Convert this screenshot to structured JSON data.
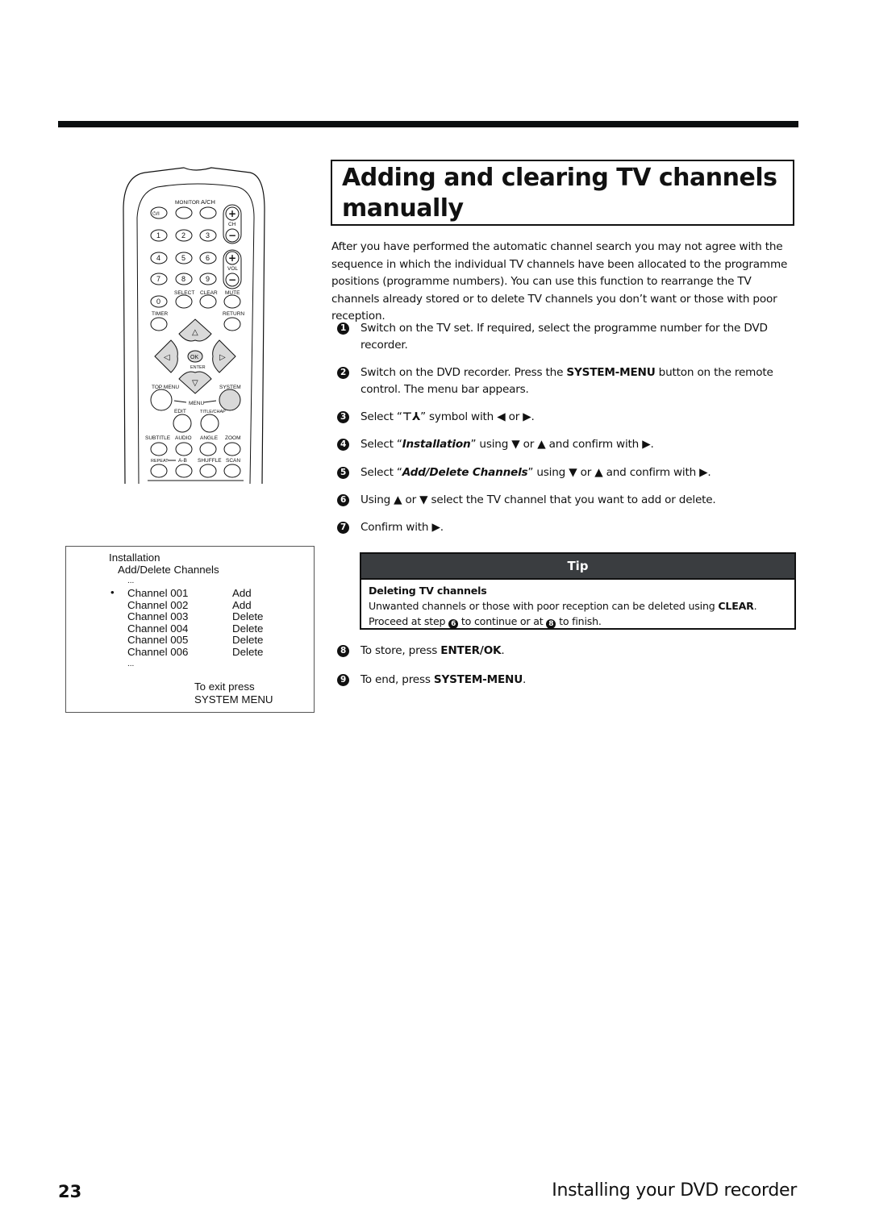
{
  "page": {
    "title_line1": "Adding and clearing TV channels",
    "title_line2": "manually",
    "intro": "After you have performed the automatic channel search you may not agree with the sequence in which the individual TV channels have been allocated to the programme positions (programme numbers). You can use this function to rearrange the TV channels already stored or to delete TV channels you don’t want or those with poor reception.",
    "page_number": "23",
    "section_title": "Installing your DVD recorder"
  },
  "steps": [
    {
      "num": "1",
      "parts": [
        "Switch on the TV set. If required, select the programme number for the DVD recorder."
      ]
    },
    {
      "num": "2",
      "pre": "Switch on the DVD recorder. Press the ",
      "bold": "SYSTEM-MENU",
      "post": " button on the remote control. The menu bar appears."
    },
    {
      "num": "3",
      "pre": "Select “",
      "symbol": "⊤⅄",
      "post": "” symbol with ◀ or ▶."
    },
    {
      "num": "4",
      "pre": "Select “",
      "bold": "Installation",
      "post": "” using ▼ or ▲ and confirm with ▶."
    },
    {
      "num": "5",
      "pre": "Select “",
      "bold": "Add/Delete Channels",
      "post": "” using ▼ or ▲ and confirm with ▶."
    },
    {
      "num": "6",
      "text": "Using ▲ or ▼ select the TV channel that you want to add or delete."
    },
    {
      "num": "7",
      "text": "Confirm with ▶."
    },
    {
      "num": "8",
      "pre": "To store, press ",
      "bold": "ENTER/OK",
      "post": "."
    },
    {
      "num": "9",
      "pre": "To end, press ",
      "bold": "SYSTEM-MENU",
      "post": "."
    }
  ],
  "tip": {
    "header": "Tip",
    "heading": "Deleting TV channels",
    "line1_pre": "Unwanted channels or those with poor reception can be deleted using ",
    "line1_bold": "CLEAR",
    "line1_post": ".",
    "line2_a": "Proceed at step ",
    "line2_ref1": "6",
    "line2_b": " to continue or at ",
    "line2_ref2": "8",
    "line2_c": " to finish."
  },
  "osd": {
    "menu": "Installation",
    "submenu": "Add/Delete Channels",
    "ellipsis_top": "...",
    "selected_marker": "•",
    "channels": [
      {
        "name": "Channel 001",
        "status": "Add"
      },
      {
        "name": "Channel 002",
        "status": "Add"
      },
      {
        "name": "Channel 003",
        "status": "Delete"
      },
      {
        "name": "Channel 004",
        "status": "Delete"
      },
      {
        "name": "Channel 005",
        "status": "Delete"
      },
      {
        "name": "Channel 006",
        "status": "Delete"
      }
    ],
    "ellipsis_bottom": "...",
    "exit_line1": "To exit press",
    "exit_line2": "SYSTEM MENU"
  },
  "remote": {
    "labels": {
      "monitor": "MONITOR",
      "ach": "A/CH",
      "ch": "CH",
      "vol": "VOL",
      "select": "SELECT",
      "clear": "CLEAR",
      "mute": "MUTE",
      "timer": "TIMER",
      "return": "RETURN",
      "ok": "OK",
      "enter": "ENTER",
      "top_menu": "TOP MENU",
      "system": "SYSTEM",
      "menu": "MENU",
      "edit": "EDIT",
      "title_chap": "TITLE/CHAP",
      "subtitle": "SUBTITLE",
      "audio": "AUDIO",
      "angle": "ANGLE",
      "zoom": "ZOOM",
      "repeat": "REPEAT",
      "ab": "A-B",
      "shuffle": "SHUFFLE",
      "scan": "SCAN",
      "power": "⏻/I"
    },
    "digits": [
      "1",
      "2",
      "3",
      "4",
      "5",
      "6",
      "7",
      "8",
      "9",
      "0"
    ]
  }
}
